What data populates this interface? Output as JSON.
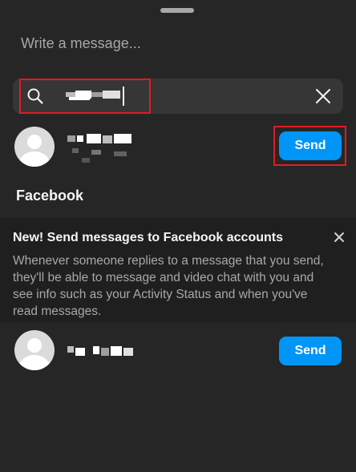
{
  "compose": {
    "placeholder": "Write a message..."
  },
  "search": {
    "icon": "search-icon",
    "clear_icon": "close-icon"
  },
  "results": [
    {
      "avatar": "default-avatar",
      "send_label": "Send"
    }
  ],
  "section": {
    "title": "Facebook"
  },
  "notice": {
    "title": "New! Send messages to Facebook accounts",
    "body": "Whenever someone replies to a message that you send, they'll be able to message and video chat with you and see info such as your Activity Status and when you've read messages.",
    "close_icon": "close-icon"
  },
  "facebook_results": [
    {
      "avatar": "default-avatar",
      "send_label": "Send"
    }
  ],
  "colors": {
    "accent": "#0095f6",
    "highlight": "#e21b23",
    "background": "#262626",
    "notice_background": "#1f1f1f"
  }
}
